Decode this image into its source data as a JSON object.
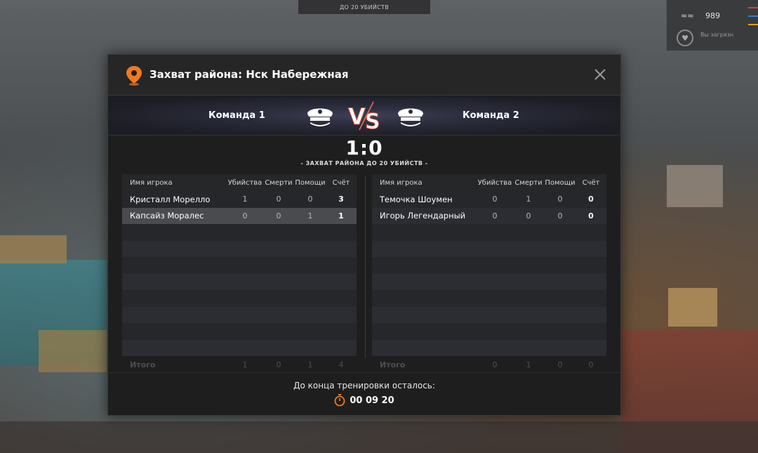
{
  "background": {
    "top_banner": "ДО 20 УБИЙСТВ",
    "hud_coins": "989",
    "hud_status": "Вы загрязн"
  },
  "modal": {
    "title": "Захват района: Нск Набережная",
    "team1": "Команда 1",
    "team2": "Команда 2",
    "score": "1:0",
    "subtitle": "- ЗАХВАТ РАЙОНА ДО 20 УБИЙСТВ -",
    "columns": {
      "name": "Имя игрока",
      "kills": "Убийства",
      "deaths": "Смерти",
      "assists": "Помощи",
      "score": "Счёт"
    },
    "team1_players": [
      {
        "name": "Кристалл Морелло",
        "kills": "1",
        "deaths": "0",
        "assists": "0",
        "score": "3"
      },
      {
        "name": "Капсайз Моралес",
        "kills": "0",
        "deaths": "0",
        "assists": "1",
        "score": "1"
      }
    ],
    "team2_players": [
      {
        "name": "Темочка Шоумен",
        "kills": "0",
        "deaths": "1",
        "assists": "0",
        "score": "0"
      },
      {
        "name": "Игорь Легендарный",
        "kills": "0",
        "deaths": "0",
        "assists": "0",
        "score": "0"
      }
    ],
    "team1_totals": {
      "label": "Итого",
      "kills": "1",
      "deaths": "0",
      "assists": "1",
      "score": "4"
    },
    "team2_totals": {
      "label": "Итого",
      "kills": "0",
      "deaths": "1",
      "assists": "0",
      "score": "0"
    },
    "timer_label": "До конца тренировки осталось:",
    "timer_value": "00 09 20"
  },
  "colors": {
    "accent_orange": "#f07a1e",
    "panel_bg": "#1e1e1f",
    "highlight_row": "#4a4b4e"
  }
}
